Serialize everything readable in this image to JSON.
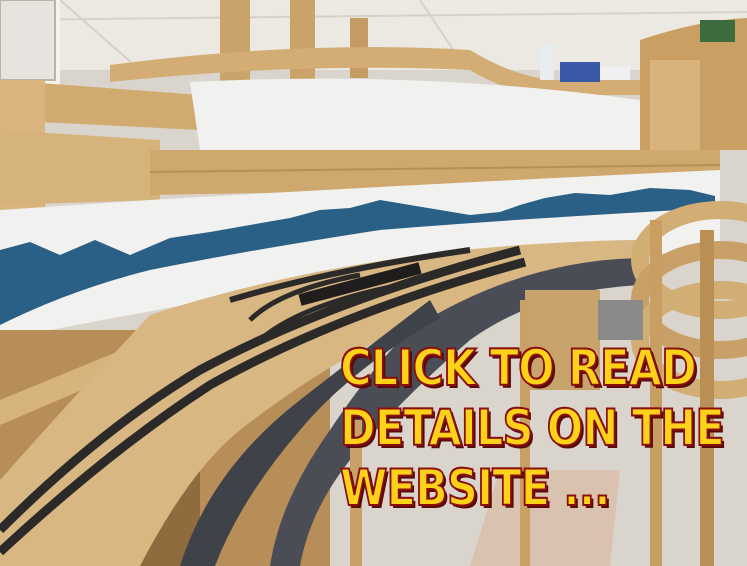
{
  "overlay": {
    "line1": "CLICK TO READ",
    "line2": "DETAILS ON THE",
    "line3": "WEBSITE ..."
  },
  "colors": {
    "text_fill": "#ffd21a",
    "text_outline": "#8a1010",
    "backdrop": "#f1f1ef",
    "mountains": "#2a5f86",
    "plywood": "#d8b783",
    "roadbed": "#4a4d55",
    "track": "#2b2a28",
    "wall": "#e8e4de"
  },
  "icons": [
    "model-railroad-photo"
  ]
}
